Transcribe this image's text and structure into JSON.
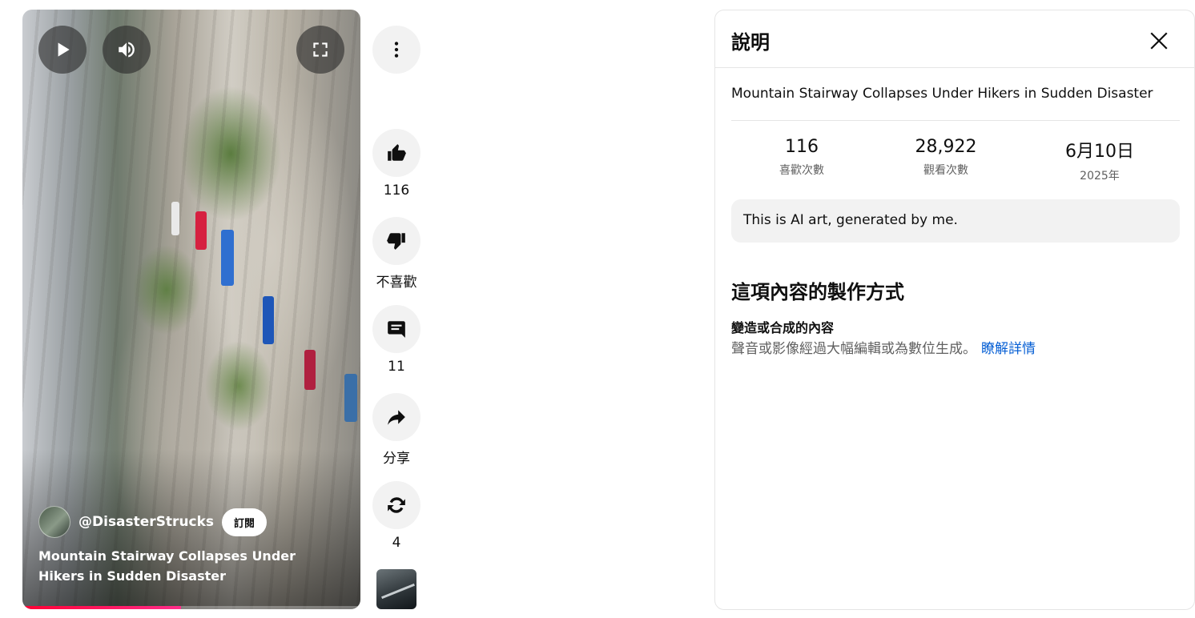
{
  "video": {
    "channel_handle": "@DisasterStrucks",
    "subscribe_label": "訂閱",
    "title": "Mountain Stairway Collapses Under Hikers in Sudden Disaster",
    "progress": 0.47,
    "controls": [
      "play-icon",
      "volume-icon",
      "fullscreen-icon"
    ]
  },
  "actions": {
    "more_icon": "more-vert-icon",
    "like_count": "116",
    "dislike_label": "不喜歡",
    "comment_count": "11",
    "share_label": "分享",
    "remix_count": "4"
  },
  "panel": {
    "title": "說明",
    "video_title": "Mountain Stairway Collapses Under Hikers in Sudden Disaster",
    "stats": [
      {
        "value": "116",
        "label": "喜歡次數"
      },
      {
        "value": "28,922",
        "label": "觀看次數"
      },
      {
        "value": "6月10日",
        "label": "2025年"
      }
    ],
    "note": "This is AI art, generated by me.",
    "how_made_heading": "這項內容的製作方式",
    "how_made_subheading": "變造或合成的內容",
    "how_made_text": "聲音或影像經過大幅編輯或為數位生成。",
    "learn_more": "瞭解詳情"
  },
  "colors": {
    "accent_link": "#065fd4",
    "progress": "#ff0033",
    "button_bg": "#f2f2f2"
  }
}
